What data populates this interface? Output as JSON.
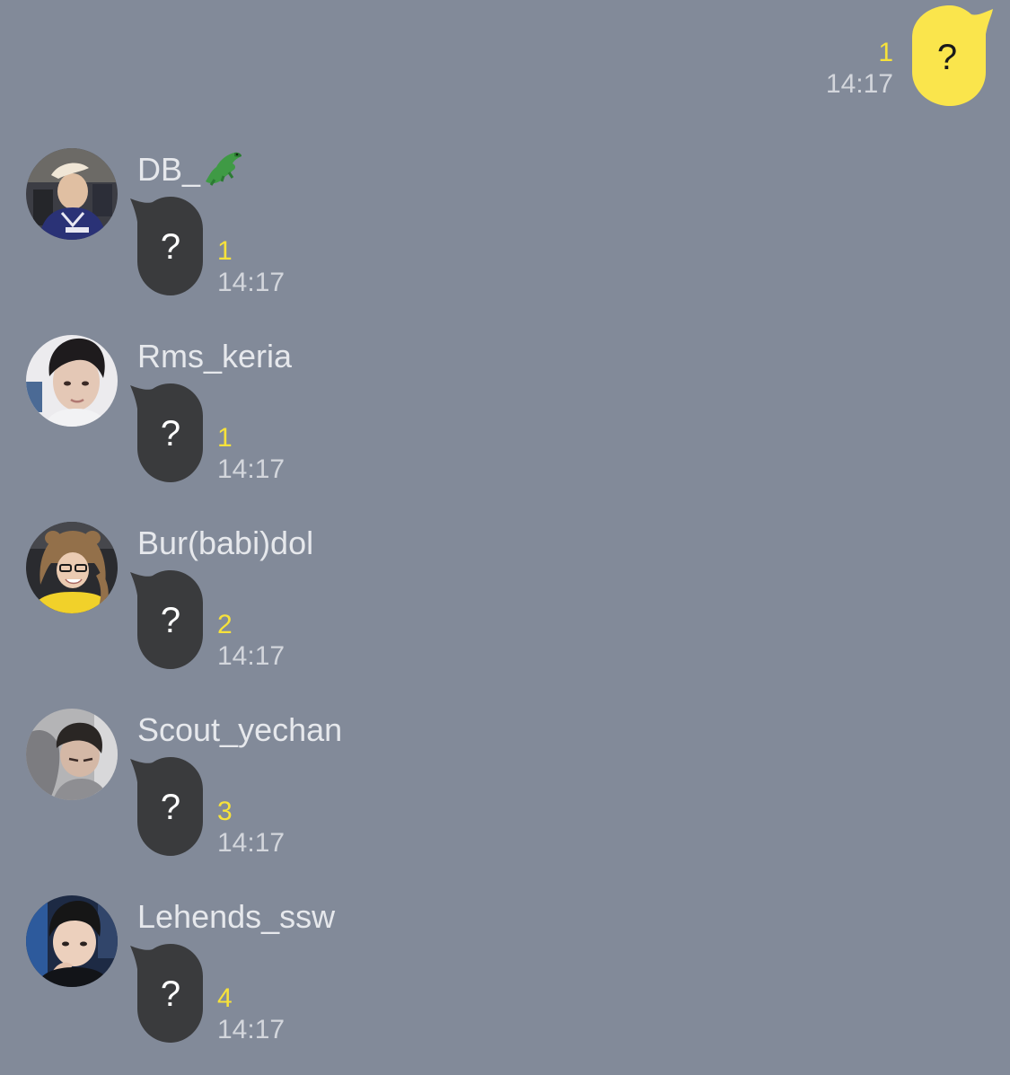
{
  "colors": {
    "background": "#828a99",
    "outgoing_bubble": "#fae54c",
    "incoming_bubble": "#3a3b3d",
    "unread_count": "#f7e23a",
    "timestamp": "#d3d6dc",
    "sender_name": "#e6e8ec"
  },
  "outgoing": {
    "text": "?",
    "unread": "1",
    "time": "14:17"
  },
  "messages": [
    {
      "sender": "DB_",
      "sender_icon": "crocodile-icon",
      "text": "?",
      "unread": "1",
      "time": "14:17"
    },
    {
      "sender": "Rms_keria",
      "text": "?",
      "unread": "1",
      "time": "14:17"
    },
    {
      "sender": "Bur(babi)dol",
      "text": "?",
      "unread": "2",
      "time": "14:17"
    },
    {
      "sender": "Scout_yechan",
      "text": "?",
      "unread": "3",
      "time": "14:17"
    },
    {
      "sender": "Lehends_ssw",
      "text": "?",
      "unread": "4",
      "time": "14:17"
    }
  ]
}
